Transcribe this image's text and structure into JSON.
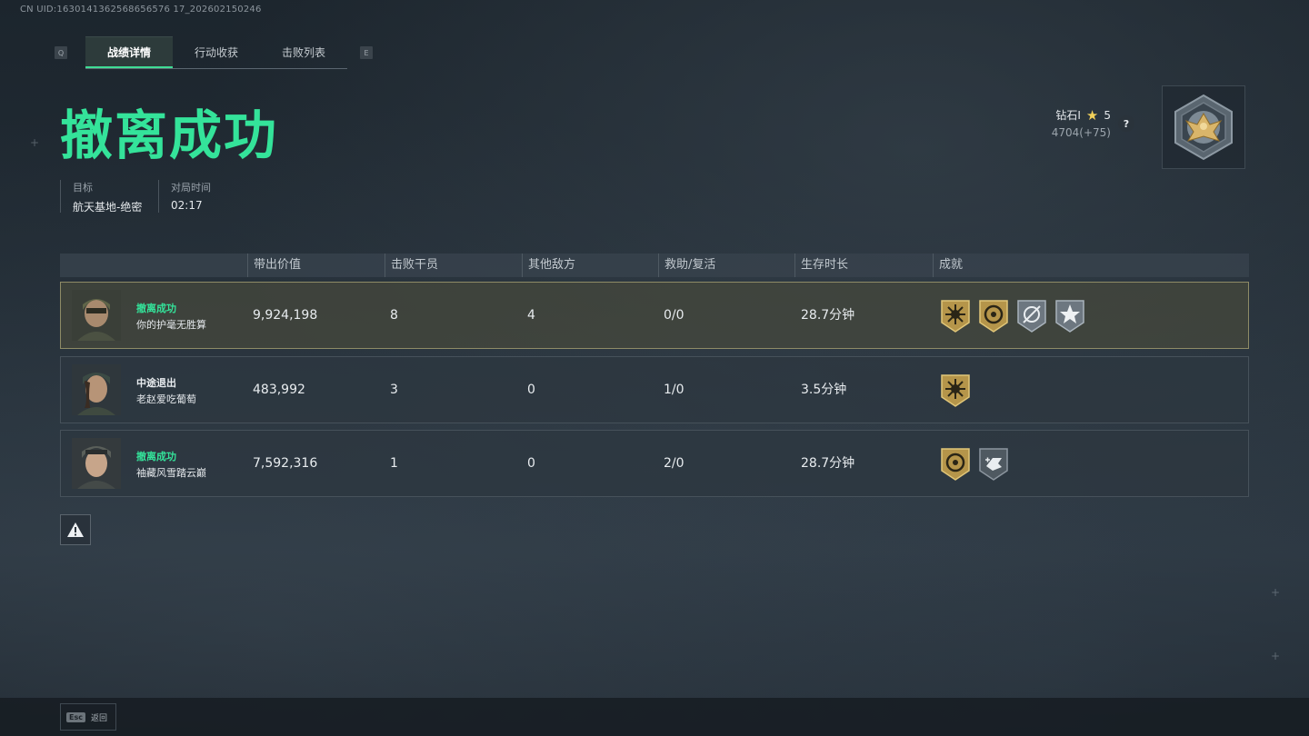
{
  "uid_text": "CN UID:1630141362568656576 17_202602150246",
  "header": {
    "tab_prev_key": "Q",
    "tab_next_key": "E",
    "tabs": [
      {
        "label": "战绩详情",
        "active": true
      },
      {
        "label": "行动收获",
        "active": false
      },
      {
        "label": "击败列表",
        "active": false
      }
    ]
  },
  "result": {
    "title": "撤离成功",
    "title_color": "#34e39a",
    "objective_label": "目标",
    "objective_value": "航天基地-绝密",
    "time_label": "对局时间",
    "time_value": "02:17"
  },
  "rank": {
    "tier": "钻石I",
    "stars": "5",
    "points": "4704(+75)",
    "help_label": "?"
  },
  "table": {
    "columns": [
      "带出价值",
      "击败干员",
      "其他敌方",
      "救助/复活",
      "生存时长",
      "成就"
    ],
    "rows": [
      {
        "status": "撤离成功",
        "status_color": "#34e39a",
        "name": "你的护毫无胜算",
        "value": "9,924,198",
        "kills": "8",
        "other": "4",
        "assist": "0/0",
        "survival": "28.7分钟",
        "achievements": [
          "gold-sun-badge",
          "gold-coin-badge",
          "silver-crosshair-badge",
          "silver-star-badge"
        ],
        "highlight": true
      },
      {
        "status": "中途退出",
        "status_color": "#e8ecef",
        "name": "老赵爱吃葡萄",
        "value": "483,992",
        "kills": "3",
        "other": "0",
        "assist": "1/0",
        "survival": "3.5分钟",
        "achievements": [
          "gold-sun-badge"
        ],
        "highlight": false
      },
      {
        "status": "撤离成功",
        "status_color": "#34e39a",
        "name": "袖藏风雪踏云巅",
        "value": "7,592,316",
        "kills": "1",
        "other": "0",
        "assist": "2/0",
        "survival": "28.7分钟",
        "achievements": [
          "gold-coin-badge",
          "silver-medic-badge"
        ],
        "highlight": false
      }
    ]
  },
  "footer": {
    "esc_key": "Esc",
    "back_label": "返回"
  }
}
